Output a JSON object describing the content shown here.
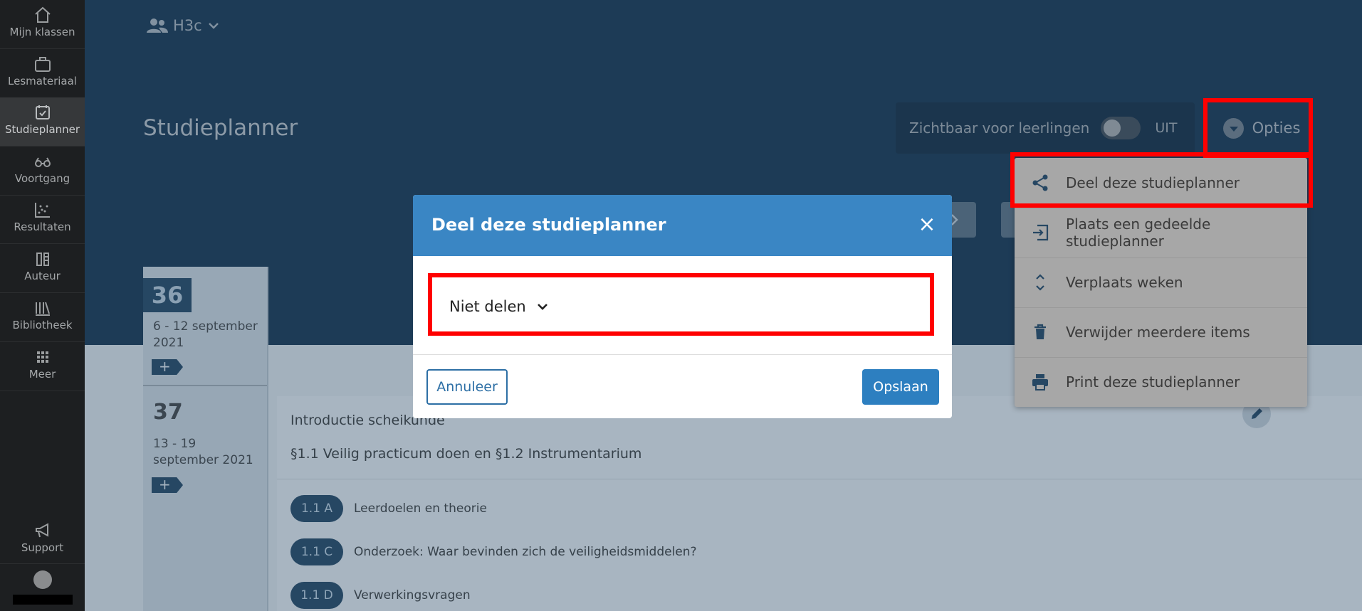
{
  "sidebar": {
    "items": [
      {
        "label": "Mijn klassen",
        "icon": "home-icon"
      },
      {
        "label": "Lesmateriaal",
        "icon": "briefcase-icon"
      },
      {
        "label": "Studieplanner",
        "icon": "calendar-check-icon",
        "active": true
      },
      {
        "label": "Voortgang",
        "icon": "glasses-icon"
      },
      {
        "label": "Resultaten",
        "icon": "scatter-chart-icon"
      },
      {
        "label": "Auteur",
        "icon": "author-icon"
      },
      {
        "label": "Bibliotheek",
        "icon": "library-icon"
      },
      {
        "label": "Meer",
        "icon": "grid-icon"
      }
    ],
    "support_label": "Support"
  },
  "header": {
    "class_name": "H3c",
    "page_title": "Studieplanner",
    "visibility_label": "Zichtbaar voor leerlingen",
    "visibility_state": "UIT",
    "options_label": "Opties"
  },
  "options_menu": {
    "items": [
      {
        "label": "Deel deze studieplanner",
        "icon": "share-icon"
      },
      {
        "label": "Plaats een gedeelde studieplanner",
        "icon": "import-icon"
      },
      {
        "label": "Verplaats weken",
        "icon": "move-vertical-icon"
      },
      {
        "label": "Verwijder meerdere items",
        "icon": "trash-icon"
      },
      {
        "label": "Print deze studieplanner",
        "icon": "print-icon"
      }
    ]
  },
  "planner": {
    "weeks": [
      {
        "number": "36",
        "dates_line1": "6 - 12 september",
        "dates_line2": "2021",
        "add": "+"
      },
      {
        "number": "37",
        "dates_line1": "13 - 19",
        "dates_line2": "september 2021",
        "add": "+"
      }
    ],
    "card": {
      "title": "Introductie scheikunde",
      "subtitle": "§1.1 Veilig practicum doen en §1.2 Instrumentarium",
      "items": [
        {
          "code": "1.1 A",
          "text": "Leerdoelen en theorie"
        },
        {
          "code": "1.1 C",
          "text": "Onderzoek: Waar bevinden zich de veiligheidsmiddelen?"
        },
        {
          "code": "1.1 D",
          "text": "Verwerkingsvragen"
        }
      ]
    }
  },
  "modal": {
    "title": "Deel deze studieplanner",
    "close": "×",
    "share_select_value": "Niet delen",
    "cancel_label": "Annuleer",
    "save_label": "Opslaan"
  },
  "colors": {
    "highlight": "#ff0000",
    "modal_header": "#3a86c4",
    "primary_button": "#2d7fc0"
  }
}
